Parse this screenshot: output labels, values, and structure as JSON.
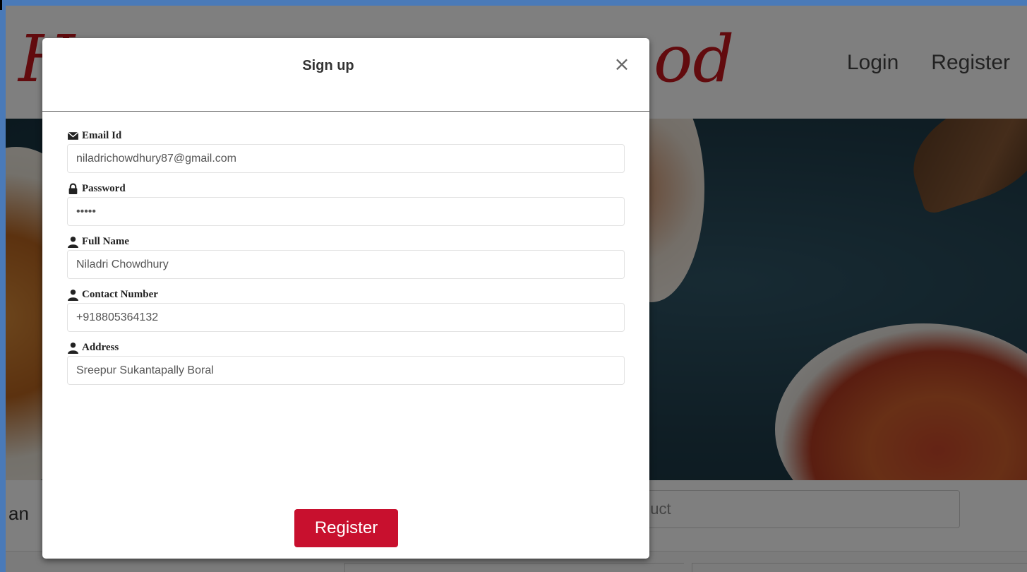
{
  "site": {
    "logo_start": "H",
    "logo_end": "od",
    "nav": {
      "login": "Login",
      "register": "Register"
    },
    "search_left_text": "an",
    "search_placeholder": "duct"
  },
  "modal": {
    "title": "Sign up",
    "close_glyph": "×",
    "fields": [
      {
        "label": "Email Id",
        "icon": "envelope-icon",
        "value": "niladrichowdhury87@gmail.com",
        "type": "text"
      },
      {
        "label": "Password",
        "icon": "lock-icon",
        "value": "•••••",
        "type": "password"
      },
      {
        "label": "Full Name",
        "icon": "user-icon",
        "value": "Niladri Chowdhury",
        "type": "text"
      },
      {
        "label": "Contact Number",
        "icon": "user-icon",
        "value": "+918805364132",
        "type": "text"
      },
      {
        "label": "Address",
        "icon": "user-icon",
        "value": "Sreepur Sukantapally Boral",
        "type": "text"
      }
    ],
    "submit_label": "Register"
  },
  "colors": {
    "brand_red": "#c8102e",
    "logo_red": "#c4161c",
    "window_border": "#4a7ab8"
  }
}
